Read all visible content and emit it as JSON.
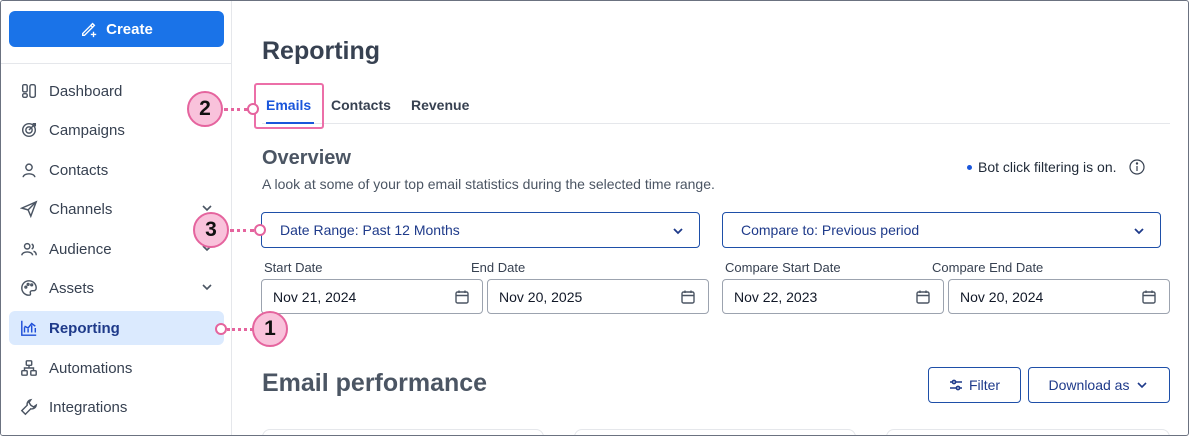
{
  "sidebar": {
    "create_label": "Create",
    "items": [
      {
        "label": "Dashboard",
        "icon": "dashboard-icon"
      },
      {
        "label": "Campaigns",
        "icon": "target-icon"
      },
      {
        "label": "Contacts",
        "icon": "person-icon"
      },
      {
        "label": "Channels",
        "icon": "send-icon",
        "expandable": true
      },
      {
        "label": "Audience",
        "icon": "people-icon",
        "expandable": true
      },
      {
        "label": "Assets",
        "icon": "palette-icon",
        "expandable": true
      },
      {
        "label": "Reporting",
        "icon": "chart-icon",
        "active": true
      },
      {
        "label": "Automations",
        "icon": "hierarchy-icon"
      },
      {
        "label": "Integrations",
        "icon": "wrench-icon"
      }
    ]
  },
  "main": {
    "title": "Reporting",
    "tabs": [
      {
        "label": "Emails",
        "active": true
      },
      {
        "label": "Contacts"
      },
      {
        "label": "Revenue"
      }
    ],
    "overview": {
      "title": "Overview",
      "subtitle": "A look at some of your top email statistics during the selected time range.",
      "bot_filter": "Bot click filtering is on."
    },
    "date_range": {
      "label": "Date Range: Past 12 Months"
    },
    "compare_to": {
      "label": "Compare to: Previous period"
    },
    "dates": {
      "start_label": "Start Date",
      "start_value": "Nov 21, 2024",
      "end_label": "End Date",
      "end_value": "Nov 20, 2025",
      "compare_start_label": "Compare Start Date",
      "compare_start_value": "Nov 22, 2023",
      "compare_end_label": "Compare End Date",
      "compare_end_value": "Nov 20, 2024"
    },
    "performance": {
      "title": "Email performance",
      "filter_label": "Filter",
      "download_label": "Download as"
    }
  },
  "callouts": {
    "one": "1",
    "two": "2",
    "three": "3"
  },
  "colors": {
    "accent": "#1a73e8",
    "active_bg": "#dbeafe",
    "callout": "#f9c2db",
    "callout_border": "#e5649e"
  }
}
